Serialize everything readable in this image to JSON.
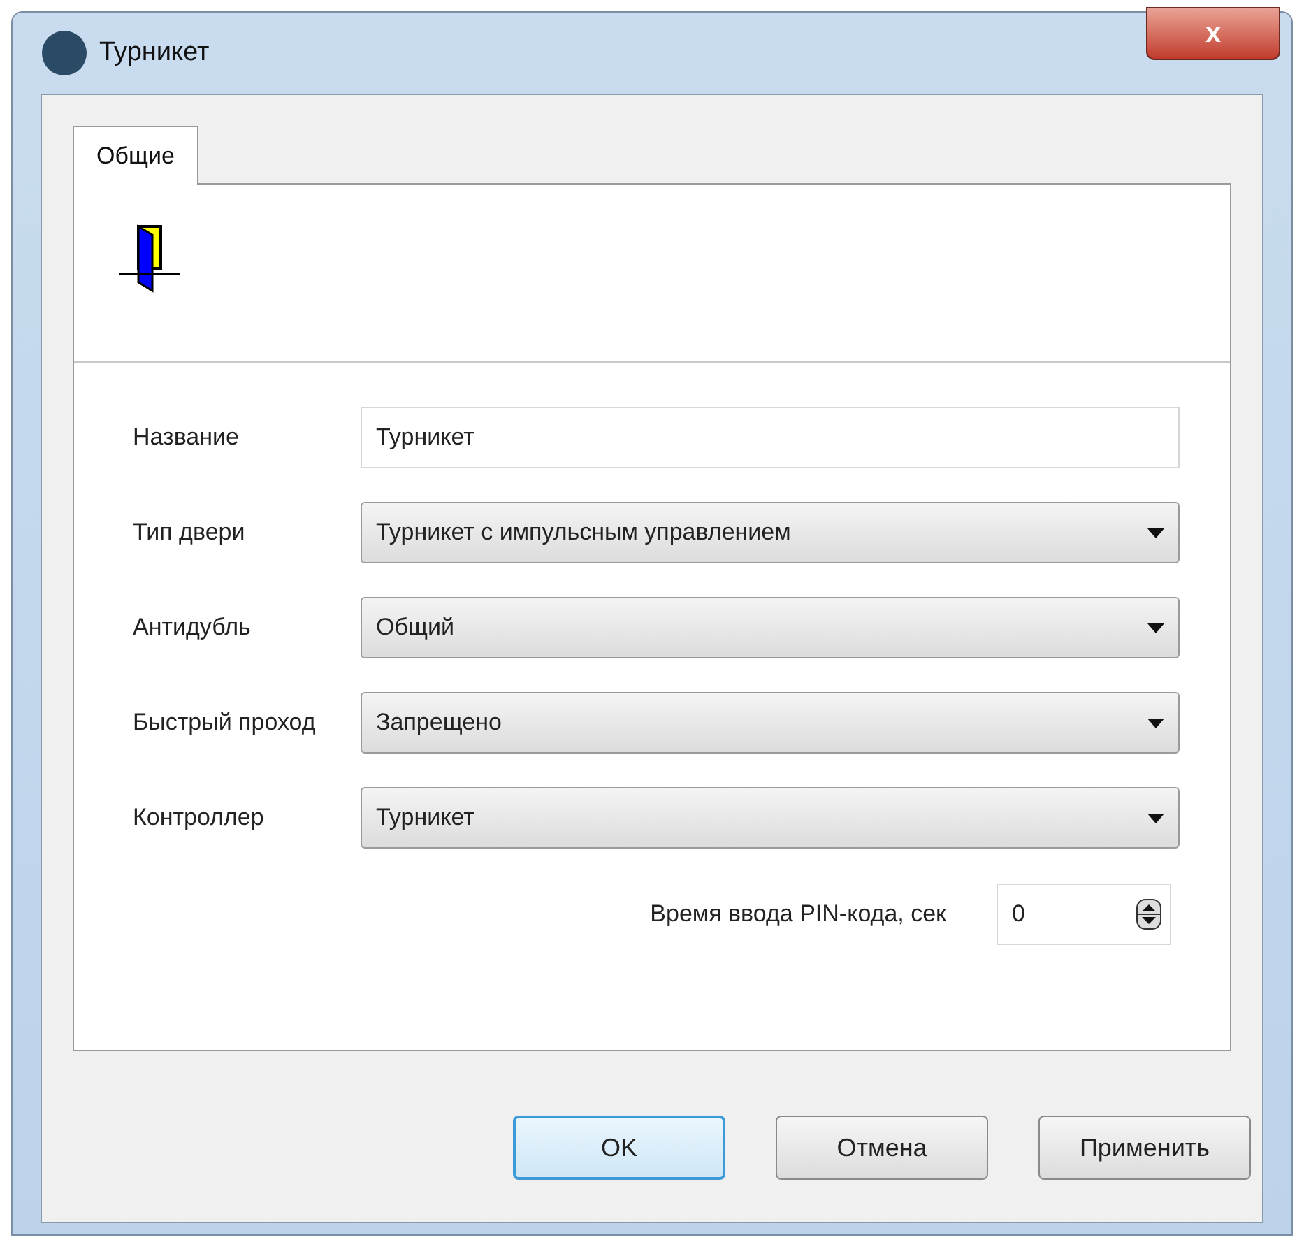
{
  "window": {
    "title": "Турникет",
    "close": "x"
  },
  "tabs": [
    {
      "label": "Общие",
      "selected": true
    }
  ],
  "fields": [
    {
      "kind": "text",
      "label": "Название",
      "value": "Турникет"
    },
    {
      "kind": "select",
      "label": "Тип двери",
      "value": "Турникет с импульсным управлением"
    },
    {
      "kind": "select",
      "label": "Антидубль",
      "value": "Общий"
    },
    {
      "kind": "select",
      "label": "Быстрый проход",
      "value": "Запрещено"
    },
    {
      "kind": "select",
      "label": "Контроллер",
      "value": "Турникет"
    },
    {
      "kind": "spinner",
      "label": "Время ввода PIN-кода, сек",
      "value": "0"
    }
  ],
  "buttons": [
    {
      "label": "OK",
      "default": true
    },
    {
      "label": "Отмена",
      "default": false
    },
    {
      "label": "Применить",
      "default": false
    }
  ]
}
